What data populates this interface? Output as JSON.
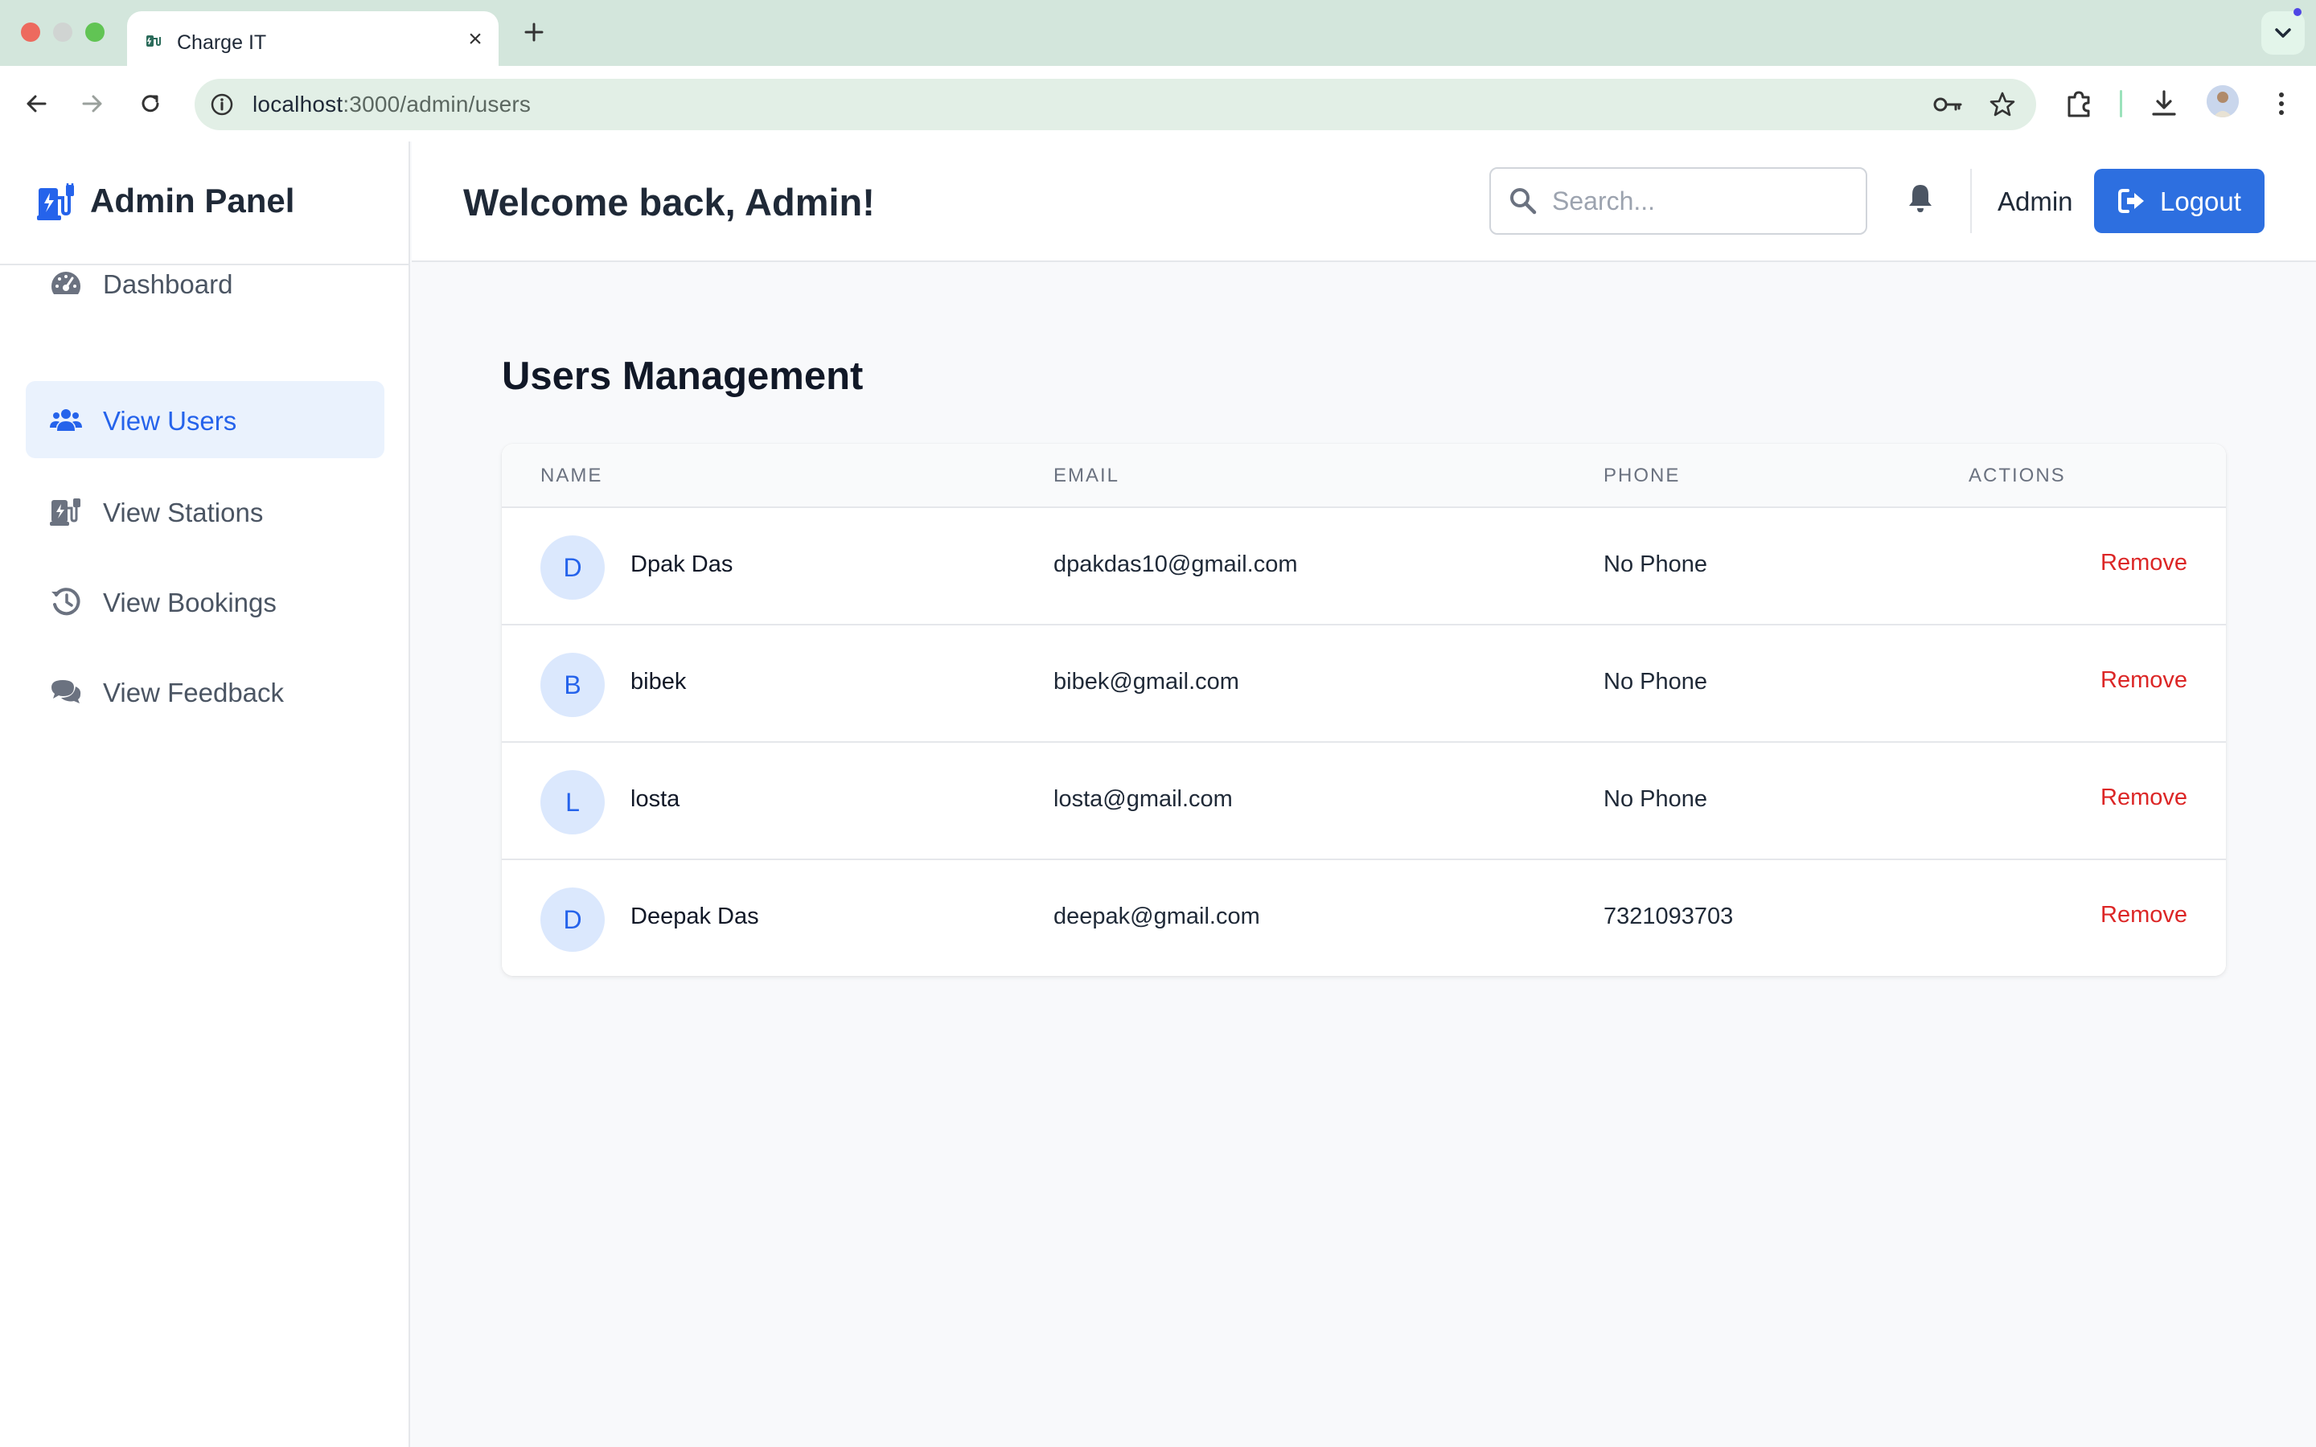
{
  "browser": {
    "tab_title": "Charge IT",
    "tab_close_glyph": "×",
    "url_host": "localhost",
    "url_path": ":3000/admin/users"
  },
  "sidebar": {
    "brand": "Admin Panel",
    "items": [
      {
        "label": "Dashboard",
        "icon": "gauge-icon",
        "active": false
      },
      {
        "label": "View Users",
        "icon": "users-icon",
        "active": true
      },
      {
        "label": "View Stations",
        "icon": "charging-station-icon",
        "active": false
      },
      {
        "label": "View Bookings",
        "icon": "history-icon",
        "active": false
      },
      {
        "label": "View Feedback",
        "icon": "comments-icon",
        "active": false
      }
    ]
  },
  "header": {
    "welcome": "Welcome back, Admin!",
    "search_placeholder": "Search...",
    "user_name": "Admin",
    "logout_label": "Logout"
  },
  "main": {
    "title": "Users Management",
    "columns": [
      "NAME",
      "EMAIL",
      "PHONE",
      "ACTIONS"
    ],
    "rows": [
      {
        "initial": "D",
        "name": "Dpak Das",
        "email": "dpakdas10@gmail.com",
        "phone": "No Phone",
        "action": "Remove"
      },
      {
        "initial": "B",
        "name": "bibek",
        "email": "bibek@gmail.com",
        "phone": "No Phone",
        "action": "Remove"
      },
      {
        "initial": "L",
        "name": "losta",
        "email": "losta@gmail.com",
        "phone": "No Phone",
        "action": "Remove"
      },
      {
        "initial": "D",
        "name": "Deepak Das",
        "email": "deepak@gmail.com",
        "phone": "7321093703",
        "action": "Remove"
      }
    ]
  },
  "colors": {
    "accent": "#2563eb",
    "logout_bg": "#2d6fe0",
    "danger": "#dc2626",
    "active_bg": "#eaf2fd"
  }
}
